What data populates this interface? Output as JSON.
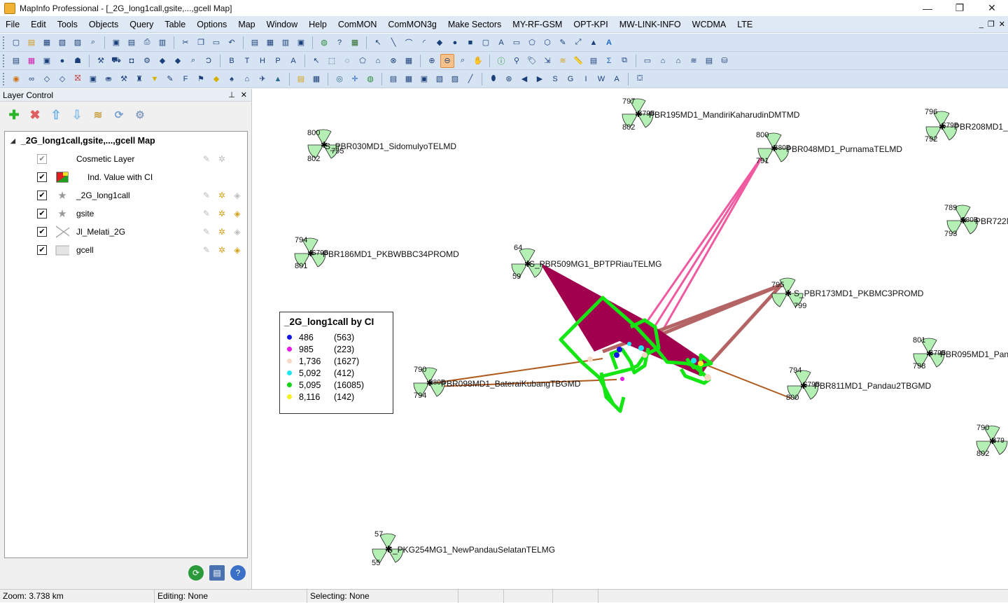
{
  "window": {
    "title": "MapInfo Professional - [_2G_long1call,gsite,...,gcell Map]",
    "controls": [
      "—",
      "❐",
      "✕"
    ]
  },
  "menubar": [
    "File",
    "Edit",
    "Tools",
    "Objects",
    "Query",
    "Table",
    "Options",
    "Map",
    "Window",
    "Help",
    "ComMON",
    "ComMON3g",
    "Make Sectors",
    "MY-RF-GSM",
    "OPT-KPI",
    "MW-LINK-INFO",
    "WCDMA",
    "LTE"
  ],
  "mdi_controls": [
    "_",
    "❐",
    "✕"
  ],
  "toolbars": {
    "row3_letters": [
      "B",
      "T",
      "H",
      "P",
      "A"
    ],
    "row4_letters": [
      "S",
      "G",
      "I",
      "W",
      "A"
    ]
  },
  "layer_control": {
    "title": "Layer Control",
    "pin": "⊥",
    "close": "✕",
    "root": "_2G_long1call,gsite,...,gcell Map",
    "layers": [
      {
        "name": "Cosmetic Layer",
        "checked": true
      },
      {
        "name": "Ind. Value with CI",
        "checked": true
      },
      {
        "name": "_2G_long1call",
        "checked": true
      },
      {
        "name": "gsite",
        "checked": true
      },
      {
        "name": "Jl_Melati_2G",
        "checked": true
      },
      {
        "name": "gcell",
        "checked": true
      }
    ]
  },
  "legend": {
    "title": "_2G_long1call by CI",
    "rows": [
      {
        "value": "486",
        "count": "(563)",
        "color": "#1414e6"
      },
      {
        "value": "985",
        "count": "(223)",
        "color": "#e619e6"
      },
      {
        "value": "1,736",
        "count": "(1627)",
        "color": "#f5d9c4"
      },
      {
        "value": "5,092",
        "count": "(412)",
        "color": "#1ee6f0"
      },
      {
        "value": "5,095",
        "count": "(16085)",
        "color": "#14d214"
      },
      {
        "value": "8,116",
        "count": "(142)",
        "color": "#f5f01e"
      }
    ]
  },
  "sites": [
    {
      "label": "S_PBR030MD1_SidomulyoTELMD",
      "n1": "800",
      "n2": "795",
      "n3": "802"
    },
    {
      "label": "PBR195MD1_MandiriKaharudinDMTMD",
      "prefix": "S79B",
      "n1": "797",
      "n3": "802"
    },
    {
      "label": "PBR208MD1_",
      "prefix": "S79B",
      "n1": "796",
      "n3": "792"
    },
    {
      "label": "PBR048MD1_PurnamaTELMD",
      "prefix": "S80B",
      "n1": "800",
      "n3": "791"
    },
    {
      "label": "PBR722N",
      "prefix": "S80B",
      "n1": "789",
      "n3": "793"
    },
    {
      "label": "PBR186MD1_PKBWBBC34PROMD",
      "prefix": "S79B",
      "n1": "794",
      "n3": "801"
    },
    {
      "label": "S_PBR509MG1_BPTPRiauTELMG",
      "n1": "64",
      "n3": "59"
    },
    {
      "label": "S_PBR173MD1_PKBMC3PROMD",
      "n1": "795",
      "n3": "799"
    },
    {
      "label": "PBR095MD1_Pan",
      "prefix": "S79B",
      "n1": "801",
      "n3": "798"
    },
    {
      "label": "PBR098MD1_BateraiKubangTBGMD",
      "prefix": "S80B",
      "n1": "790",
      "n3": "794"
    },
    {
      "label": "PBR811MD1_Pandau2TBGMD",
      "prefix": "S79B",
      "n1": "794",
      "n3": "800"
    },
    {
      "label": "",
      "prefix": "S79",
      "n1": "790",
      "n3": "802"
    },
    {
      "label": "S_PKG254MG1_NewPandauSelatanTELMG",
      "n1": "57",
      "n3": "55"
    }
  ],
  "map_colors": {
    "sector_fill": "#b4f0b4",
    "drive_route": "#14e614",
    "serving_area": "#a0004e",
    "pink_link": "#f05aa0",
    "brown_link": "#b05a1e",
    "rose_link": "#b46464"
  },
  "status": {
    "zoom": "Zoom: 3.738 km",
    "editing": "Editing: None",
    "selecting": "Selecting: None"
  }
}
